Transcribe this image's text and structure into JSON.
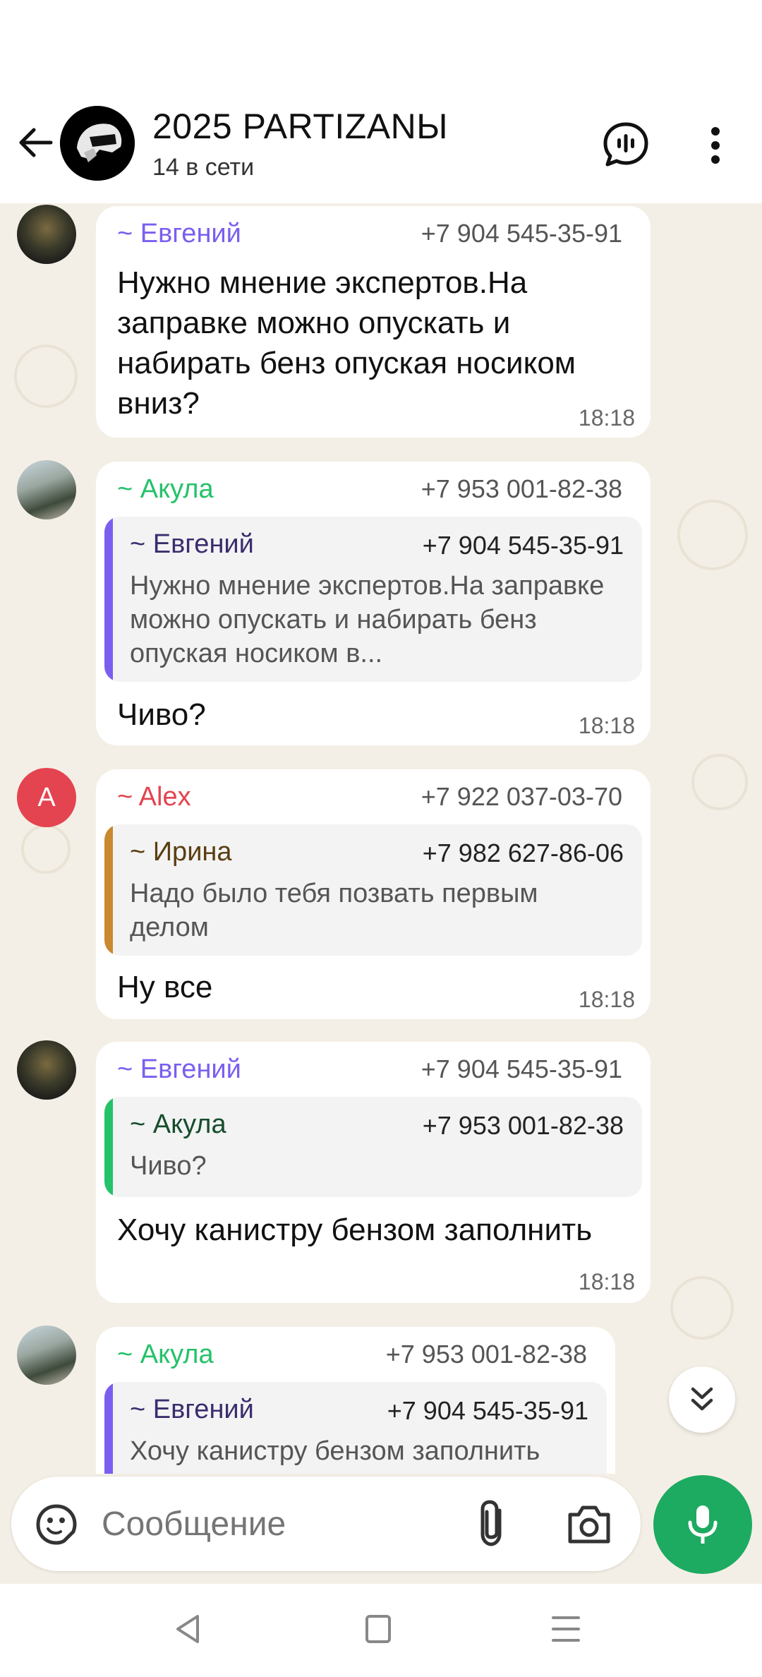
{
  "header": {
    "title": "2025 PARTIZANЫ",
    "subtitle": "14 в сети"
  },
  "messages": [
    {
      "sender": "~ Евгений",
      "sender_color": "#7b5ef0",
      "phone": "+7 904 545-35-91",
      "text": "Нужно мнение экспертов.На заправке можно опускать и набирать бенз опуская носиком вниз?",
      "time": "18:18"
    },
    {
      "sender": "~ Акула",
      "sender_color": "#25c26a",
      "phone": "+7 953 001-82-38",
      "quote": {
        "sender": "~ Евгений",
        "phone": "+7 904 545-35-91",
        "text": "Нужно мнение экспертов.На заправке можно опускать и набирать бенз опуская носиком в...",
        "bar_color": "#7b5ef0",
        "sender_color": "#3b2d6e"
      },
      "text": "Чиво?",
      "time": "18:18"
    },
    {
      "sender": "~ Alex",
      "sender_color": "#e3444f",
      "avatar_letter": "A",
      "phone": "+7 922 037-03-70",
      "quote": {
        "sender": "~ Ирина",
        "phone": "+7 982 627-86-06",
        "text": "Надо было тебя позвать первым делом",
        "bar_color": "#c9892e",
        "sender_color": "#5a3e12"
      },
      "text": "Ну все",
      "time": "18:18"
    },
    {
      "sender": "~ Евгений",
      "sender_color": "#7b5ef0",
      "phone": "+7 904 545-35-91",
      "quote": {
        "sender": "~ Акула",
        "phone": "+7 953 001-82-38",
        "text": "Чиво?",
        "bar_color": "#25c26a",
        "sender_color": "#164d2c"
      },
      "text": "Хочу канистру бензом заполнить",
      "time": "18:18"
    },
    {
      "sender": "~ Акула",
      "sender_color": "#25c26a",
      "phone": "+7 953 001-82-38",
      "quote": {
        "sender": "~ Евгений",
        "phone": "+7 904 545-35-91",
        "text": "Хочу канистру бензом заполнить",
        "bar_color": "#7b5ef0",
        "sender_color": "#3b2d6e"
      }
    }
  ],
  "composer": {
    "placeholder": "Сообщение"
  },
  "icons": {
    "back": "arrow-left-icon",
    "voice_chat": "voice-chat-icon",
    "menu": "more-vertical-icon",
    "sticker": "sticker-icon",
    "attach": "paperclip-icon",
    "camera": "camera-icon",
    "mic": "microphone-icon",
    "scroll_down": "double-chevron-down-icon"
  },
  "colors": {
    "accent": "#1daa61",
    "chat_background": "#f4efe6"
  }
}
